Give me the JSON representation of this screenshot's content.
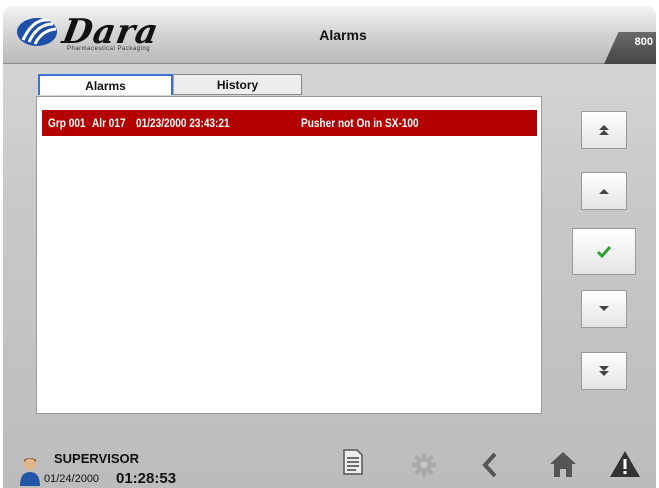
{
  "header": {
    "logo_text": "Dara",
    "logo_tagline": "Pharmaceutical Packaging",
    "title": "Alarms",
    "screen_code": "800"
  },
  "tabs": [
    {
      "label": "Alarms",
      "active": true
    },
    {
      "label": "History",
      "active": false
    }
  ],
  "alarms": [
    {
      "group": "Grp 001",
      "alarm": "Alr 017",
      "datetime": "01/23/2000 23:43:21",
      "message": "Pusher not On in SX-100"
    }
  ],
  "nav_buttons": [
    "scroll-top",
    "scroll-up",
    "acknowledge",
    "scroll-down",
    "scroll-bottom"
  ],
  "footer": {
    "user": "SUPERVISOR",
    "date": "01/24/2000",
    "time": "01:28:53",
    "icons": [
      "document-icon",
      "gear-icon",
      "back-icon",
      "home-icon",
      "warning-icon"
    ]
  },
  "colors": {
    "alarm_row": "#b30000",
    "active_tab_border": "#3d73d6",
    "ack_check": "#2ea12e"
  }
}
